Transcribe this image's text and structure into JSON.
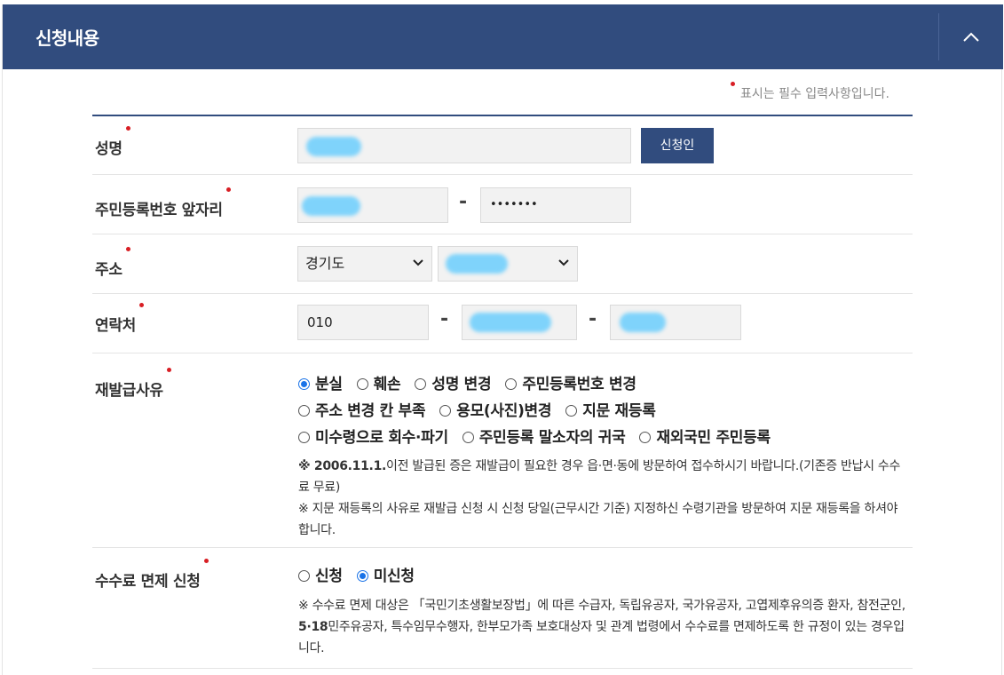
{
  "header": {
    "title": "신청내용"
  },
  "required_note": "표시는 필수 입력사항입니다.",
  "name": {
    "label": "성명",
    "button": "신청인"
  },
  "rrn": {
    "label": "주민등록번호 앞자리",
    "dash": "-",
    "masked": "•••••••"
  },
  "address": {
    "label": "주소",
    "province": "경기도"
  },
  "contact": {
    "label": "연락처",
    "prefix": "010",
    "dash1": "-",
    "dash2": "-"
  },
  "reason": {
    "label": "재발급사유",
    "options": [
      "분실",
      "훼손",
      "성명 변경",
      "주민등록번호 변경",
      "주소 변경 칸 부족",
      "용모(사진)변경",
      "지문 재등록",
      "미수령으로 회수·파기",
      "주민등록 말소자의 귀국",
      "재외국민 주민등록"
    ],
    "selected": "분실",
    "note1_bold": "※ 2006.11.1.",
    "note1_rest": "이전 발급된 증은 재발급이 필요한 경우 읍·면·동에 방문하여 접수하시기 바랍니다.(기존증 반납시 수수료 무료)",
    "note2": "※ 지문 재등록의 사유로 재발급 신청 시 신청 당일(근무시간 기준) 지정하신 수령기관을 방문하여 지문 재등록을 하셔야 합니다."
  },
  "fee": {
    "label": "수수료 면제 신청",
    "options": [
      "신청",
      "미신청"
    ],
    "selected": "미신청",
    "note_a": "※ 수수료 면제 대상은 「국민기초생활보장법」에 따른 수급자, 독립유공자, 국가유공자, 고엽제후유의증 환자, 참전군인, ",
    "note_b": "5·18",
    "note_c": "민주유공자, 특수임무수행자, 한부모가족 보호대상자 및 관계 법령에서 수수료를 면제하도록 한 규정이 있는 경우입니다."
  },
  "colors": {
    "header_bg": "#314c7e",
    "required": "#d81e24",
    "radio_selected": "#1a73e8",
    "redaction": "#7fd3fb"
  }
}
